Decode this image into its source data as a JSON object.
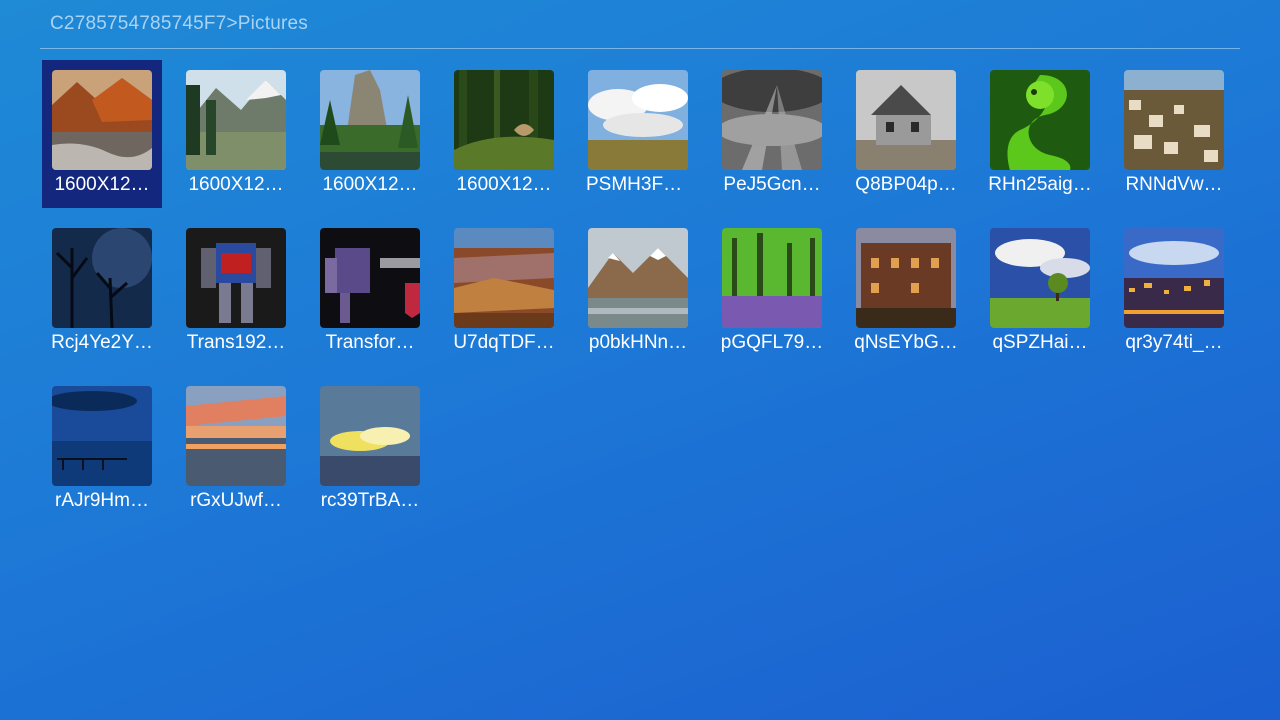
{
  "breadcrumb": "C2785754785745F7>Pictures",
  "selected_index": 0,
  "files": [
    {
      "label": "1600X12…",
      "icon": "mountain-lake-image"
    },
    {
      "label": "1600X12…",
      "icon": "alpine-lake-image"
    },
    {
      "label": "1600X12…",
      "icon": "rock-spire-forest-image"
    },
    {
      "label": "1600X12…",
      "icon": "forest-snake-image"
    },
    {
      "label": "PSMH3FJ…",
      "icon": "clouds-field-image"
    },
    {
      "label": "PeJ5Gcn…",
      "icon": "sunbeam-clouds-image"
    },
    {
      "label": "Q8BP04p…",
      "icon": "old-house-image"
    },
    {
      "label": "RHn25aig…",
      "icon": "green-snake-image"
    },
    {
      "label": "RNNdVw…",
      "icon": "hillside-town-image"
    },
    {
      "label": "Rcj4Ye2Y…",
      "icon": "night-trees-image"
    },
    {
      "label": "Trans192…",
      "icon": "robot-image"
    },
    {
      "label": "Transfor…",
      "icon": "robot-logo-image"
    },
    {
      "label": "U7dqTDF…",
      "icon": "canyon-image"
    },
    {
      "label": "p0bkHNn…",
      "icon": "snowy-mountains-image"
    },
    {
      "label": "pGQFL79…",
      "icon": "bluebell-forest-image"
    },
    {
      "label": "qNsEYbG…",
      "icon": "ruined-building-image"
    },
    {
      "label": "qSPZHai…",
      "icon": "lone-tree-image"
    },
    {
      "label": "qr3y74ti_…",
      "icon": "city-night-image"
    },
    {
      "label": "rAJr9Hm…",
      "icon": "blue-pier-image"
    },
    {
      "label": "rGxUJwf…",
      "icon": "sunset-beach-image"
    },
    {
      "label": "rc39TrBA…",
      "icon": "sky-clouds-image"
    }
  ]
}
